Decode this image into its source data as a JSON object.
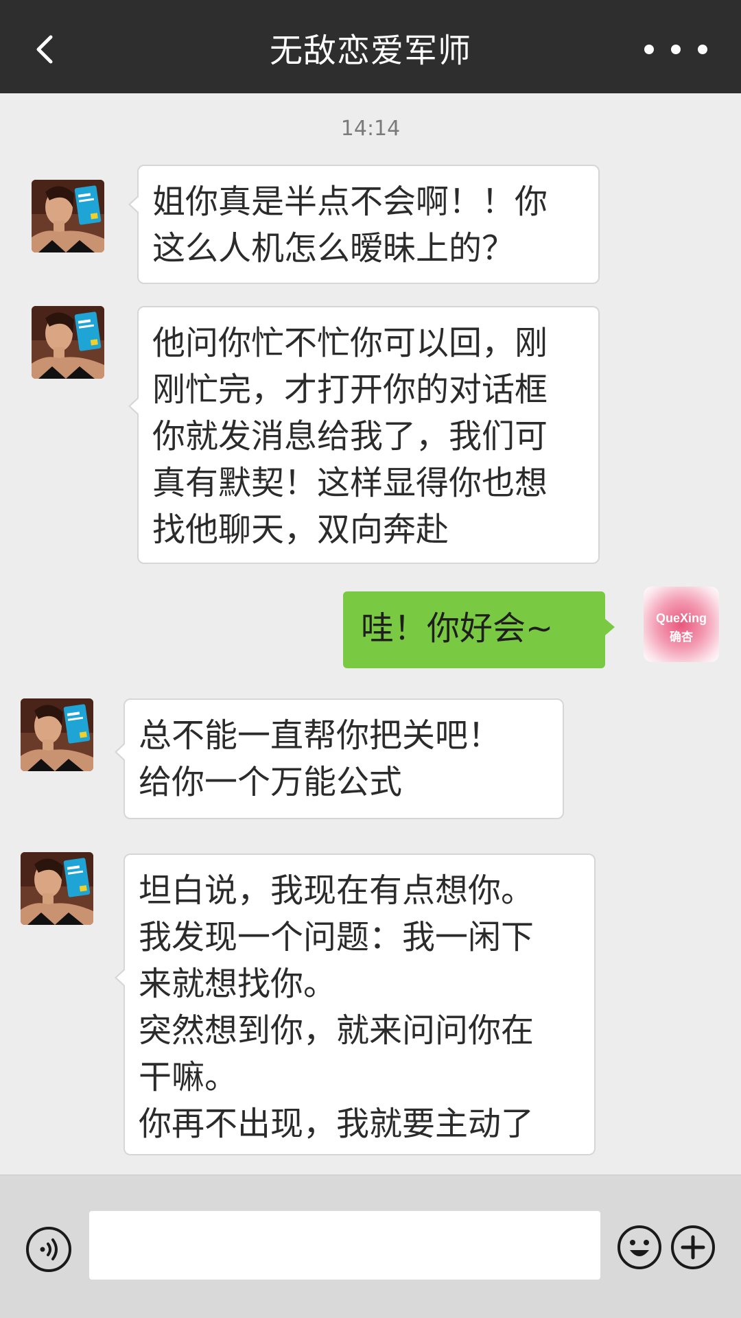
{
  "header": {
    "title": "无敌恋爱军师",
    "back_icon": "chevron-left-icon",
    "more_icon": "more-dots-icon"
  },
  "timestamp": "14:14",
  "messages": [
    {
      "sender": "other",
      "text": "姐你真是半点不会啊！！你\n这么人机怎么暧昧上的？"
    },
    {
      "sender": "other",
      "text": "他问你忙不忙你可以回，刚\n刚忙完，才打开你的对话框\n你就发消息给我了，我们可\n真有默契！这样显得你也想\n找他聊天，双向奔赴"
    },
    {
      "sender": "me",
      "text": "哇！你好会~"
    },
    {
      "sender": "other",
      "text": "总不能一直帮你把关吧！\n给你一个万能公式"
    },
    {
      "sender": "other",
      "text": "坦白说，我现在有点想你。\n我发现一个问题：我一闲下\n来就想找你。\n突然想到你，就来问问你在\n干嘛。\n你再不出现，我就要主动了"
    }
  ],
  "my_avatar": {
    "line1": "QueXing",
    "line2": "确杏"
  },
  "input_bar": {
    "placeholder": "",
    "value": "",
    "voice_icon": "voice-icon",
    "emoji_icon": "emoji-icon",
    "plus_icon": "plus-icon"
  },
  "colors": {
    "header_bg": "#2e2e2e",
    "chat_bg": "#ededed",
    "my_bubble": "#7ac943",
    "other_bubble": "#ffffff"
  }
}
